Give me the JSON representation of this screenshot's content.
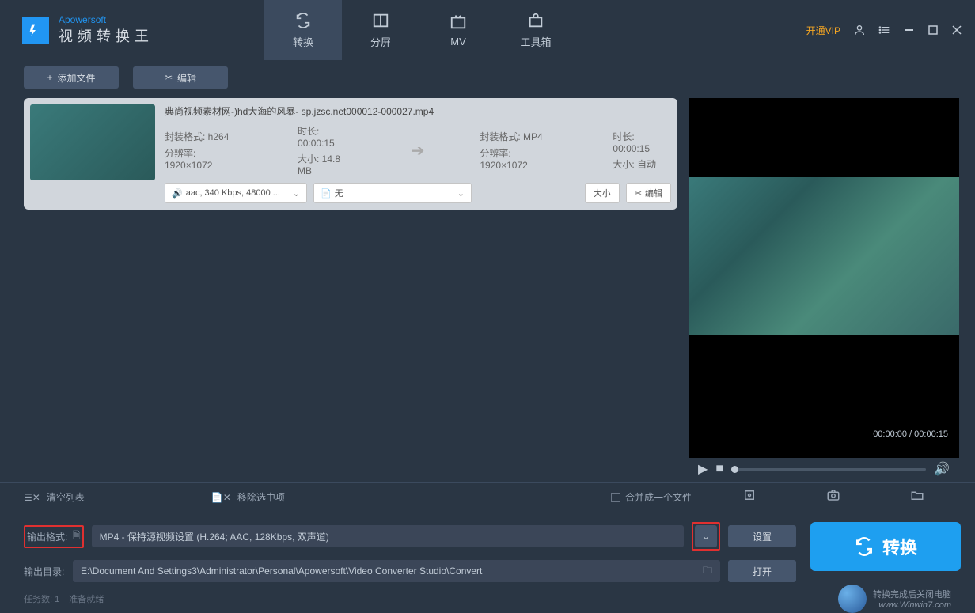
{
  "brand": "Apowersoft",
  "appTitle": "视频转换王",
  "vip": "开通VIP",
  "tabs": {
    "convert": "转换",
    "split": "分屏",
    "mv": "MV",
    "toolbox": "工具箱"
  },
  "toolbar": {
    "addFile": "添加文件",
    "edit": "编辑"
  },
  "file": {
    "name": "典尚视频素材网-)hd大海的风暴- sp.jzsc.net000012-000027.mp4",
    "src": {
      "codec": "封装格式: h264",
      "res": "分辨率: 1920×1072",
      "dur": "时长: 00:00:15",
      "size": "大小: 14.8 MB"
    },
    "dst": {
      "codec": "封装格式: MP4",
      "res": "分辨率: 1920×1072",
      "dur": "时长: 00:00:15",
      "size": "大小: 自动"
    },
    "audio": "aac, 340 Kbps, 48000 ...",
    "subtitle": "无",
    "sizeBtn": "大小",
    "editBtn": "编辑"
  },
  "preview": {
    "time": "00:00:00 / 00:00:15"
  },
  "listBar": {
    "clear": "清空列表",
    "remove": "移除选中项",
    "merge": "合并成一个文件"
  },
  "output": {
    "formatLabel": "输出格式:",
    "formatValue": "MP4 - 保持源视频设置 (H.264; AAC, 128Kbps, 双声道)",
    "dirLabel": "输出目录:",
    "dirValue": "E:\\Document And Settings3\\Administrator\\Personal\\Apowersoft\\Video Converter Studio\\Convert",
    "settings": "设置",
    "open": "打开",
    "convert": "转换"
  },
  "status": {
    "tasks": "任务数: 1",
    "ready": "准备就绪",
    "shutdown": "转换完成后关闭电脑",
    "url": "www.Winwin7.com"
  }
}
